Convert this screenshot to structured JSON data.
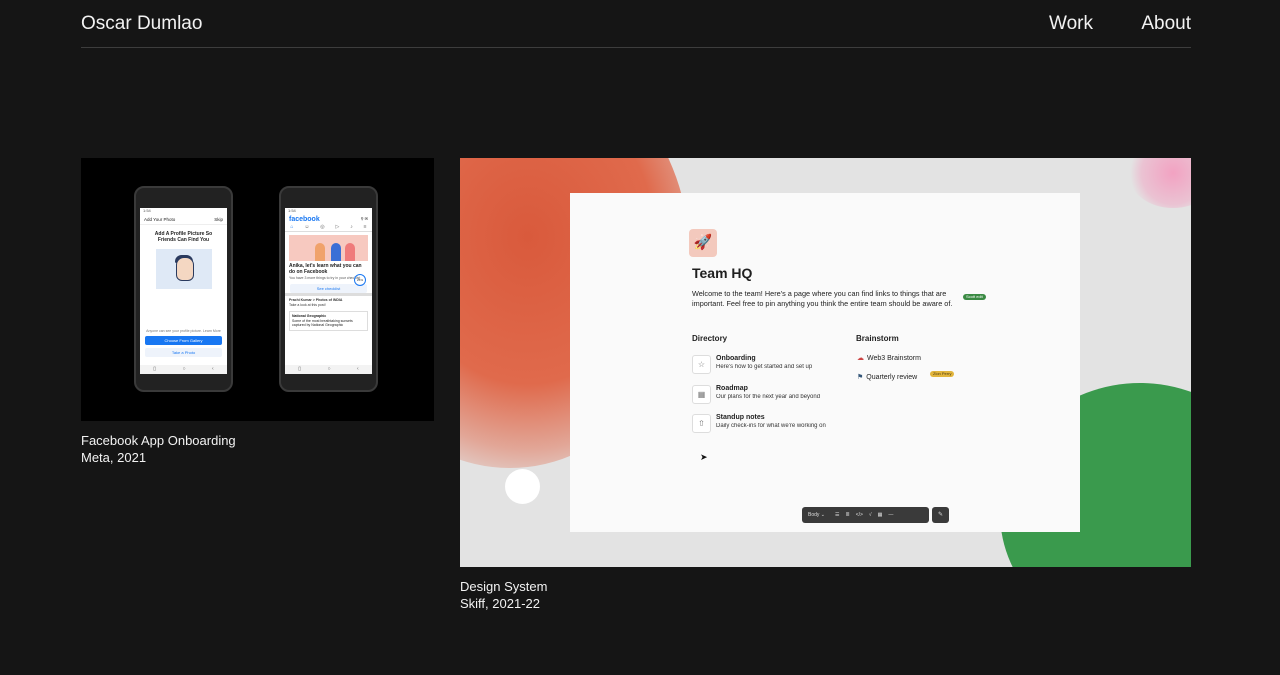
{
  "header": {
    "site_title": "Oscar Dumlao",
    "nav": {
      "work": "Work",
      "about": "About"
    }
  },
  "projects": [
    {
      "title": "Facebook App Onboarding",
      "meta": "Meta, 2021",
      "preview": {
        "phone1": {
          "header_title": "Add Your Photo",
          "header_action": "Skip",
          "heading": "Add A Profile Picture So Friends Can Find You",
          "note": "Anyone can see your profile picture. Learn More",
          "primary_button": "Choose From Gallery",
          "secondary_button": "Take a Photo"
        },
        "phone2": {
          "logo": "facebook",
          "card_title": "Anika, let's learn what you can do on Facebook",
          "card_sub": "You have 3 more things to try in your checklist",
          "card_button": "See checklist",
          "progress": "25%",
          "post_author": "Prachi Kumar > Photos of INDIA",
          "post_text": "Take a look at this post!",
          "shared_page": "National Geographic",
          "shared_text": "Some of the most breathtaking sunsets captured by National Geographic"
        }
      }
    },
    {
      "title": "Design System",
      "meta": "Skiff, 2021-22",
      "preview": {
        "doc_title": "Team HQ",
        "doc_desc": "Welcome to the team! Here's a page where you can find links to things that are important. Feel free to pin anything you think the entire team should be aware of.",
        "desc_tag": "Scott edit",
        "directory_heading": "Directory",
        "directory": [
          {
            "title": "Onboarding",
            "subtitle": "Here's how to get started and set up"
          },
          {
            "title": "Roadmap",
            "subtitle": "Our plans for the next year and beyond"
          },
          {
            "title": "Standup notes",
            "subtitle": "Daily check-ins for what we're working on"
          }
        ],
        "brainstorm_heading": "Brainstorm",
        "brainstorm": [
          {
            "title": "Web3 Brainstorm"
          },
          {
            "title": "Quarterly review"
          }
        ],
        "brainstorm_tag": "Zion Perry",
        "toolbar_style": "Body"
      }
    }
  ]
}
